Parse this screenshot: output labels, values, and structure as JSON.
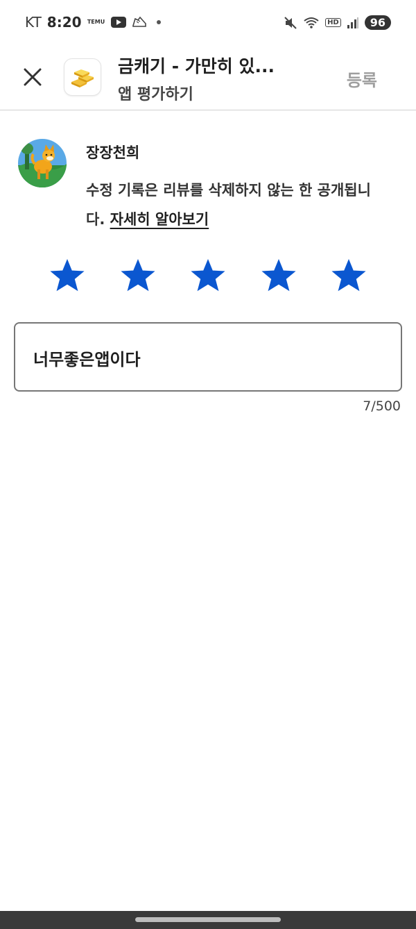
{
  "status_bar": {
    "carrier": "KT",
    "time": "8:20",
    "temu_label": "TEMU",
    "battery": "96",
    "hd_label": "HD"
  },
  "header": {
    "app_title": "금캐기 - 가만히 있...",
    "subtitle": "앱 평가하기",
    "submit_label": "등록"
  },
  "user": {
    "name": "장장천희",
    "notice_text": "수정 기록은 리뷰를 삭제하지 않는 한 공개됩니다.",
    "learn_more": "자세히 알아보기"
  },
  "rating": {
    "value": 5,
    "max": 5,
    "color": "#0b57d0"
  },
  "review": {
    "text": "너무좋은앱이다",
    "counter": "7/500"
  }
}
